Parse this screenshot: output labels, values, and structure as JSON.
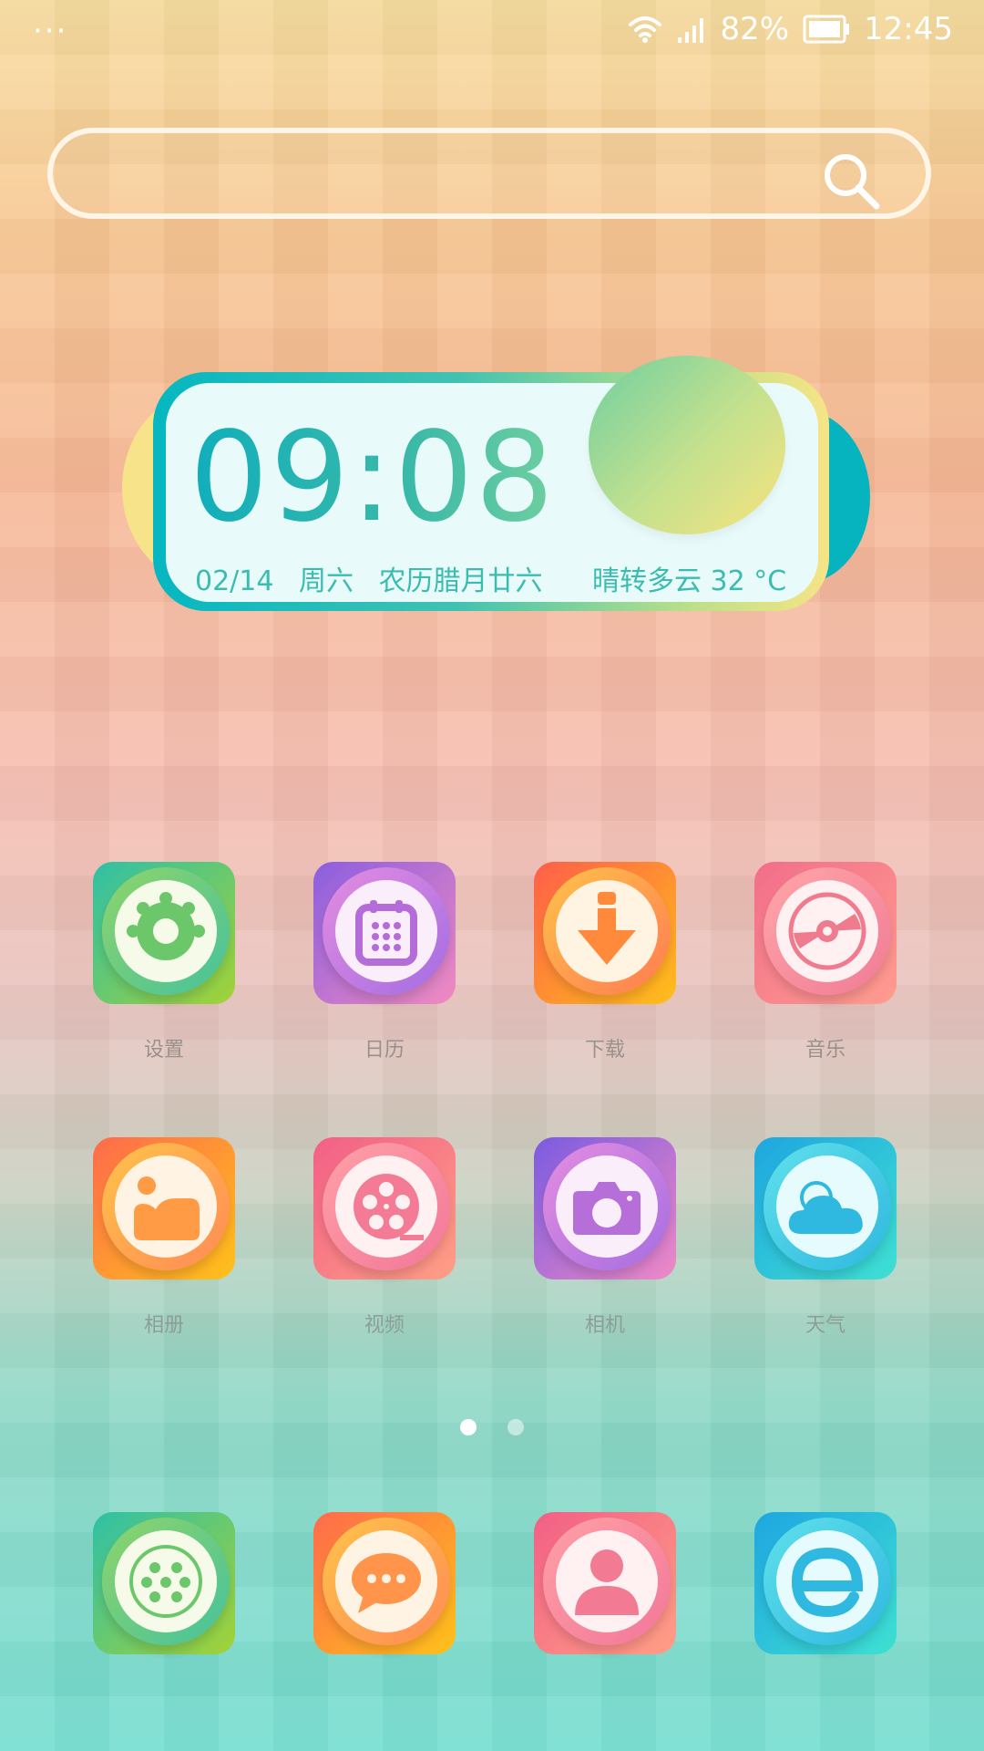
{
  "status_bar": {
    "menu": "···",
    "battery": "82%",
    "time": "12:45",
    "icons": [
      "wifi-icon",
      "signal-icon",
      "battery-icon"
    ]
  },
  "search": {
    "placeholder": "",
    "icon": "search-icon"
  },
  "clock_widget": {
    "time": "09:08",
    "date": "02/14",
    "weekday": "周六",
    "lunar": "农历腊月廿六",
    "weather": "晴转多云",
    "temperature": "32 °C",
    "icon": "sun-icon"
  },
  "apps": [
    {
      "label": "设置",
      "icon": "settings-icon",
      "color": "#7dcd6a"
    },
    {
      "label": "日历",
      "icon": "calendar-icon",
      "color": "#b86ed9"
    },
    {
      "label": "下载",
      "icon": "download-icon",
      "color": "#ff8d3c"
    },
    {
      "label": "音乐",
      "icon": "music-disc-icon",
      "color": "#f07b8e"
    },
    {
      "label": "相册",
      "icon": "gallery-icon",
      "color": "#ff9a45"
    },
    {
      "label": "视频",
      "icon": "video-reel-icon",
      "color": "#f47b95"
    },
    {
      "label": "相机",
      "icon": "camera-icon",
      "color": "#b66fd8"
    },
    {
      "label": "天气",
      "icon": "weather-cloud-icon",
      "color": "#2fc0e0"
    }
  ],
  "dock": [
    {
      "icon": "dialer-icon",
      "color": "#7dcd6a"
    },
    {
      "icon": "messages-icon",
      "color": "#ff944a"
    },
    {
      "icon": "contacts-icon",
      "color": "#f27b93"
    },
    {
      "icon": "browser-icon",
      "color": "#2fc0e0"
    }
  ],
  "pager": {
    "pages": 2,
    "active": 1
  },
  "colors": {
    "widget_text": "#3bbcaf",
    "label_text": "#9a8f8a"
  }
}
